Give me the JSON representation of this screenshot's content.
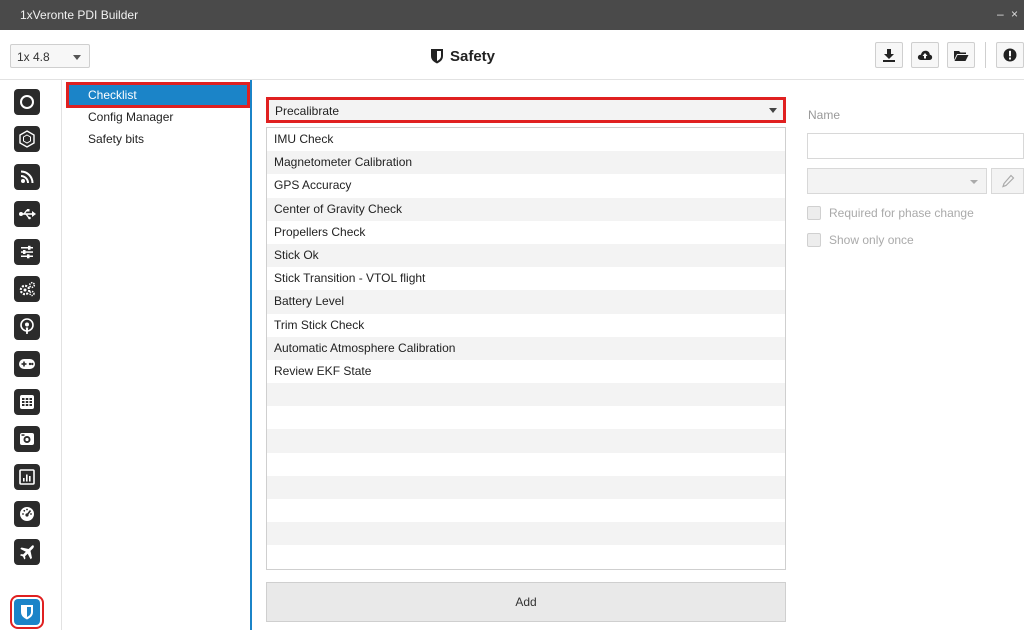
{
  "window": {
    "title": "1xVeronte PDI Builder",
    "controls": "– ×"
  },
  "header": {
    "version": "1x 4.8",
    "title": "Safety",
    "title_icon": "shield-icon",
    "toolbar": [
      "download-icon",
      "cloud-icon",
      "folder-open-icon",
      "info-icon"
    ]
  },
  "rail": {
    "icons": [
      "power-icon",
      "hexagon-icon",
      "rss-icon",
      "usb-icon",
      "sliders-icon",
      "gears-icon",
      "podcast-icon",
      "gamepad-icon",
      "keypad-icon",
      "camera-icon",
      "bar-chart-icon",
      "gauge-icon",
      "plane-icon",
      "shield-icon"
    ],
    "active": "shield-icon"
  },
  "subnav": {
    "items": [
      {
        "label": "Checklist"
      },
      {
        "label": "Config Manager"
      },
      {
        "label": "Safety bits"
      }
    ],
    "selected": "Checklist"
  },
  "main": {
    "phase": "Precalibrate",
    "checklist": [
      "IMU Check",
      "Magnetometer Calibration",
      "GPS Accuracy",
      "Center of Gravity Check",
      "Propellers Check",
      "Stick Ok",
      "Stick Transition - VTOL flight",
      "Battery Level",
      "Trim Stick Check",
      "Automatic Atmosphere Calibration",
      "Review EKF State"
    ],
    "add_label": "Add"
  },
  "form": {
    "name_label": "Name",
    "name_value": "",
    "type_value": "",
    "required_label": "Required for phase change",
    "show_once_label": "Show only once"
  },
  "colors": {
    "accent": "#1b84c8",
    "highlight": "#e02020",
    "rail_icon": "#2b2b2b"
  }
}
